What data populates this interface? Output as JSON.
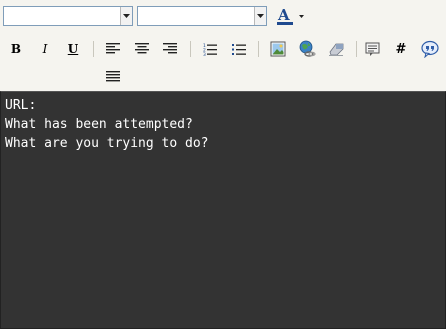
{
  "toolbar": {
    "font_family": {
      "value": "",
      "icon": "chevron-down-icon"
    },
    "font_size": {
      "value": "",
      "icon": "chevron-down-icon"
    },
    "font_color": {
      "label": "A",
      "accent": "#1f4a8f",
      "icon": "font-color-icon"
    },
    "bold": {
      "label": "B"
    },
    "italic": {
      "label": "I"
    },
    "underline": {
      "label": "U"
    },
    "buttons": [
      "bold-icon",
      "italic-icon",
      "underline-icon",
      "align-left-icon",
      "align-center-icon",
      "align-right-icon",
      "justify-icon",
      "ordered-list-icon",
      "unordered-list-icon",
      "insert-image-icon",
      "insert-link-icon",
      "eraser-icon",
      "code-icon",
      "hash-icon",
      "quote-icon"
    ],
    "hash": {
      "label": "#"
    }
  },
  "content": {
    "lines": [
      "URL:",
      "What has been attempted?",
      "What are you trying to do?"
    ]
  },
  "colors": {
    "toolbar_bg": "#f5f4ef",
    "content_bg": "#333333",
    "content_text": "#ffffff"
  }
}
